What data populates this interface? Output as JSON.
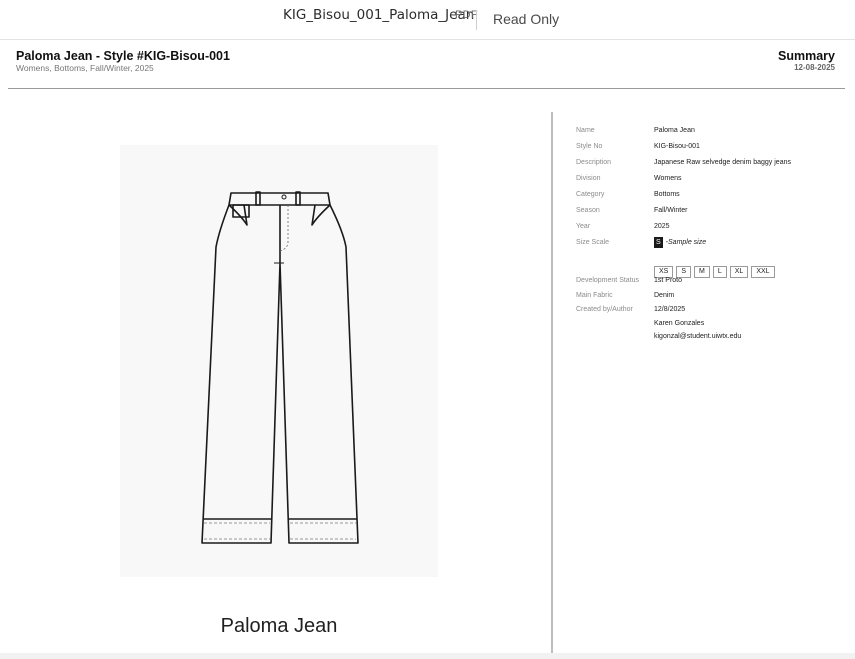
{
  "viewer": {
    "document_title": "KIG_Bisou_001_Paloma_Jean",
    "document_type": "PDF",
    "mode": "Read Only"
  },
  "header": {
    "title": "Paloma Jean - Style #KIG-Bisou-001",
    "subtitle": "Womens, Bottoms, Fall/Winter, 2025",
    "section": "Summary",
    "date": "12-08-2025"
  },
  "sketch": {
    "caption": "Paloma Jean"
  },
  "spec": {
    "rows": [
      {
        "label": "Name",
        "value": "Paloma Jean"
      },
      {
        "label": "Style No",
        "value": "KIG-Bisou-001"
      },
      {
        "label": "Description",
        "value": "Japanese Raw selvedge denim baggy jeans"
      },
      {
        "label": "Division",
        "value": "Womens"
      },
      {
        "label": "Category",
        "value": "Bottoms"
      },
      {
        "label": "Season",
        "value": "Fall/Winter"
      },
      {
        "label": "Year",
        "value": "2025"
      }
    ],
    "size_scale": {
      "label": "Size Scale",
      "selected": "S",
      "note": "-Sample size",
      "sizes": [
        "XS",
        "S",
        "M",
        "L",
        "XL",
        "XXL"
      ]
    },
    "rows_after": [
      {
        "label": "Development Status",
        "value": "1st Proto"
      },
      {
        "label": "Main Fabric",
        "value": "Denim"
      },
      {
        "label": "Created by/Author",
        "value": "12/8/2025"
      }
    ],
    "author": {
      "name": "Karen Gonzales",
      "email": "kigonzal@student.uiwtx.edu"
    }
  }
}
